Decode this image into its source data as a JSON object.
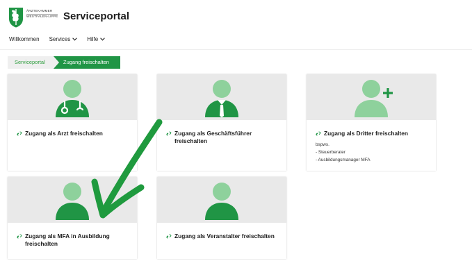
{
  "header": {
    "org_line1": "ÄRZTEKAMMER",
    "org_line2": "WESTFALEN-LIPPE",
    "app_title": "Serviceportal"
  },
  "nav": [
    {
      "label": "Willkommen",
      "dropdown": false
    },
    {
      "label": "Services",
      "dropdown": true
    },
    {
      "label": "Hilfe",
      "dropdown": true
    }
  ],
  "breadcrumb": [
    "Serviceportal",
    "Zugang freischalten"
  ],
  "cards": [
    {
      "title": "Zugang als Arzt freischalten",
      "icon": "doctor-icon",
      "desc_intro": "",
      "desc_items": []
    },
    {
      "title": "Zugang als Geschäftsführer freischalten",
      "icon": "manager-icon",
      "desc_intro": "",
      "desc_items": []
    },
    {
      "title": "Zugang als Dritter freischalten",
      "icon": "user-add-icon",
      "desc_intro": "bspws.",
      "desc_items": [
        "- Steuerberater",
        "- Ausbildungsmanager MFA"
      ]
    },
    {
      "title": "Zugang als MFA in Ausbildung freischalten",
      "icon": "user-icon",
      "desc_intro": "",
      "desc_items": []
    },
    {
      "title": "Zugang als Veranstalter freischalten",
      "icon": "user-icon",
      "desc_intro": "",
      "desc_items": []
    }
  ],
  "colors": {
    "brand_green": "#209545",
    "icon_light_green": "#8ed19c",
    "card_header_gray": "#e9e9e9",
    "arrow_annotation": "#1f9a3e"
  }
}
